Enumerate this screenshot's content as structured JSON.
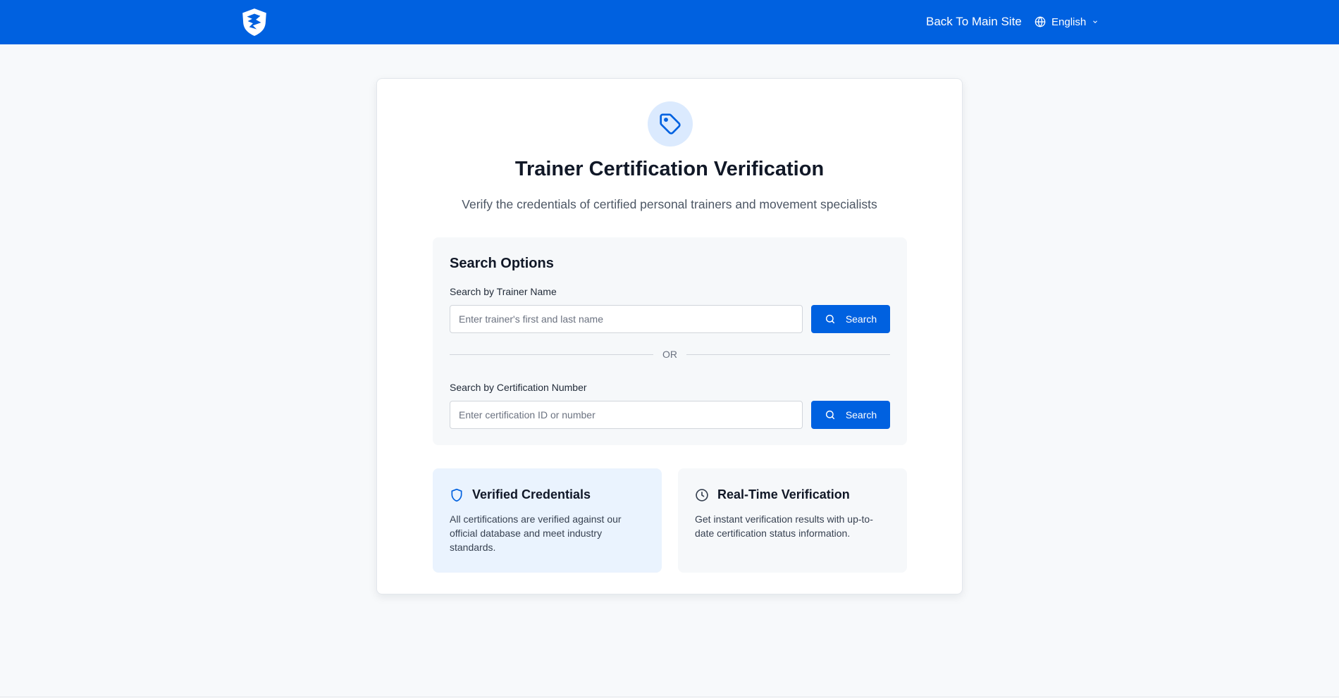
{
  "header": {
    "logo_icon": "shield-logo-icon",
    "back_link": "Back To Main Site",
    "language": "English",
    "bg_color": "#0061e0"
  },
  "hero": {
    "icon": "tag-icon",
    "title": "Trainer Certification Verification",
    "subtitle": "Verify the credentials of certified personal trainers and movement specialists"
  },
  "search": {
    "heading": "Search Options",
    "name_label": "Search by Trainer Name",
    "name_placeholder": "Enter trainer's first and last name",
    "name_value": "",
    "or_label": "OR",
    "cert_label": "Search by Certification Number",
    "cert_placeholder": "Enter certification ID or number",
    "cert_value": "",
    "button_label": "Search"
  },
  "features": [
    {
      "icon": "shield-icon",
      "title": "Verified Credentials",
      "text": "All certifications are verified against our official database and meet industry standards."
    },
    {
      "icon": "clock-icon",
      "title": "Real-Time Verification",
      "text": "Get instant verification results with up-to-date certification status information."
    }
  ],
  "colors": {
    "accent": "#0061e0",
    "hero_icon_bg": "#dbeafe",
    "feature_highlight_bg": "#eaf3fe"
  }
}
